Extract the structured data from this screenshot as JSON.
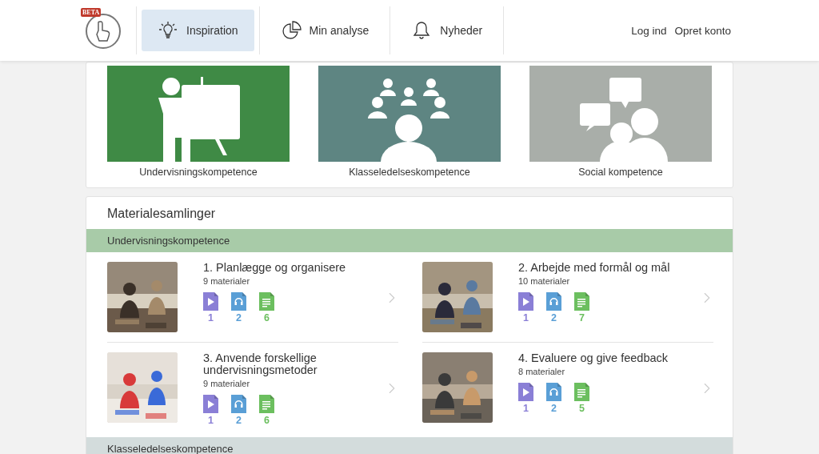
{
  "header": {
    "badge": "BETA",
    "nav": [
      {
        "label": "Inspiration",
        "kind": "bulb",
        "selected": true
      },
      {
        "label": "Min analyse",
        "kind": "pie",
        "selected": false
      },
      {
        "label": "Nyheder",
        "kind": "bell",
        "selected": false
      }
    ],
    "links": [
      "Log ind",
      "Opret konto"
    ]
  },
  "tiles": [
    {
      "label": "Undervisningskompetence",
      "kind": "teacher",
      "color": "#3f8a45"
    },
    {
      "label": "Klasseledelseskompetence",
      "kind": "class",
      "color": "#5e8582"
    },
    {
      "label": "Social kompetence",
      "kind": "social",
      "color": "#a9aea9"
    }
  ],
  "collections": {
    "title": "Materialesamlinger",
    "groups": [
      {
        "label": "Undervisningskompetence",
        "color": "#a8cba8",
        "items": [
          {
            "title": "1. Planlægge og organisere",
            "count": "9 materialer",
            "media": [
              {
                "kind": "video",
                "count": "1"
              },
              {
                "kind": "audio",
                "count": "2"
              },
              {
                "kind": "doc",
                "count": "6"
              }
            ]
          },
          {
            "title": "2. Arbejde med formål og mål",
            "count": "10 materialer",
            "media": [
              {
                "kind": "video",
                "count": "1"
              },
              {
                "kind": "audio",
                "count": "2"
              },
              {
                "kind": "doc",
                "count": "7"
              }
            ]
          },
          {
            "title": "3. Anvende forskellige undervisningsmetoder",
            "count": "9 materialer",
            "media": [
              {
                "kind": "video",
                "count": "1"
              },
              {
                "kind": "audio",
                "count": "2"
              },
              {
                "kind": "doc",
                "count": "6"
              }
            ]
          },
          {
            "title": "4. Evaluere og give feedback",
            "count": "8 materialer",
            "media": [
              {
                "kind": "video",
                "count": "1"
              },
              {
                "kind": "audio",
                "count": "2"
              },
              {
                "kind": "doc",
                "count": "5"
              }
            ]
          }
        ]
      },
      {
        "label": "Klasseledelseskompetence",
        "color": "#d3dcdc"
      }
    ]
  }
}
